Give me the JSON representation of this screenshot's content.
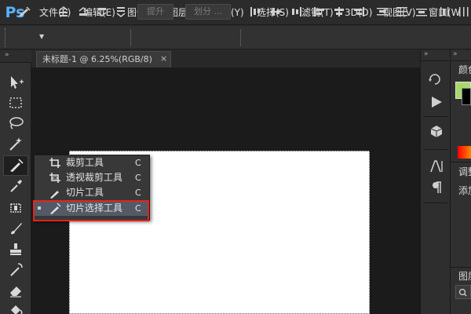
{
  "app": {
    "logo": "Ps"
  },
  "menu": [
    "文件(F)",
    "编辑(E)",
    "图像(I)",
    "图层(L)",
    "文字(Y)",
    "选择(S)",
    "滤镜(T)",
    "3D(D)",
    "视图(V)",
    "窗口(W"
  ],
  "options_bar": {
    "extract_label": "提升",
    "divide_label": "划分 ..."
  },
  "document": {
    "tab_title": "未标题-1 @ 6.25%(RGB/8)",
    "close_glyph": "×"
  },
  "tools": [
    "move-tool-icon",
    "marquee-tool-icon",
    "lasso-tool-icon",
    "magic-wand-tool-icon",
    "slice-tool-icon",
    "eyedropper-tool-icon",
    "healing-brush-tool-icon",
    "brush-tool-icon",
    "clone-stamp-tool-icon",
    "history-brush-tool-icon",
    "eraser-tool-icon",
    "paint-bucket-tool-icon"
  ],
  "flyout": {
    "items": [
      {
        "label": "裁剪工具",
        "shortcut": "C",
        "icon": "crop-icon"
      },
      {
        "label": "透视裁剪工具",
        "shortcut": "C",
        "icon": "perspective-crop-icon"
      },
      {
        "label": "切片工具",
        "shortcut": "C",
        "icon": "slice-icon"
      },
      {
        "label": "切片选择工具",
        "shortcut": "C",
        "icon": "slice-select-icon",
        "selected": true
      }
    ]
  },
  "right_panel": {
    "color_tab": "颜色",
    "adjust_tab": "调整",
    "add_label": "添加",
    "layers_tab": "图层"
  },
  "colors": {
    "accent": "#59b1ff",
    "highlight_box": "#e4231b",
    "swatch": "#a8d86a"
  }
}
